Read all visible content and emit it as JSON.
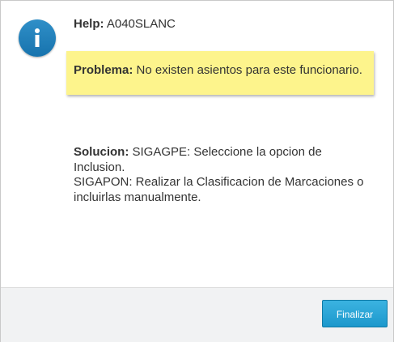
{
  "dialog": {
    "icon": "info-icon",
    "help_label": "Help:",
    "help_code": "A040SLANC",
    "problem_label": "Problema:",
    "problem_text": "No existen asientos para este funcionario.",
    "solution_label": "Solucion:",
    "solution_lines": [
      "SIGAGPE: Seleccione la opcion de",
      "Inclusion.",
      "SIGAPON: Realizar la Clasificacion de Marcaciones o",
      "incluirlas manualmente."
    ]
  },
  "footer": {
    "finalizar_label": "Finalizar"
  },
  "colors": {
    "icon_blue": "#1f7fbd",
    "problem_background": "#fdf48c",
    "button_blue": "#26a3d6"
  }
}
